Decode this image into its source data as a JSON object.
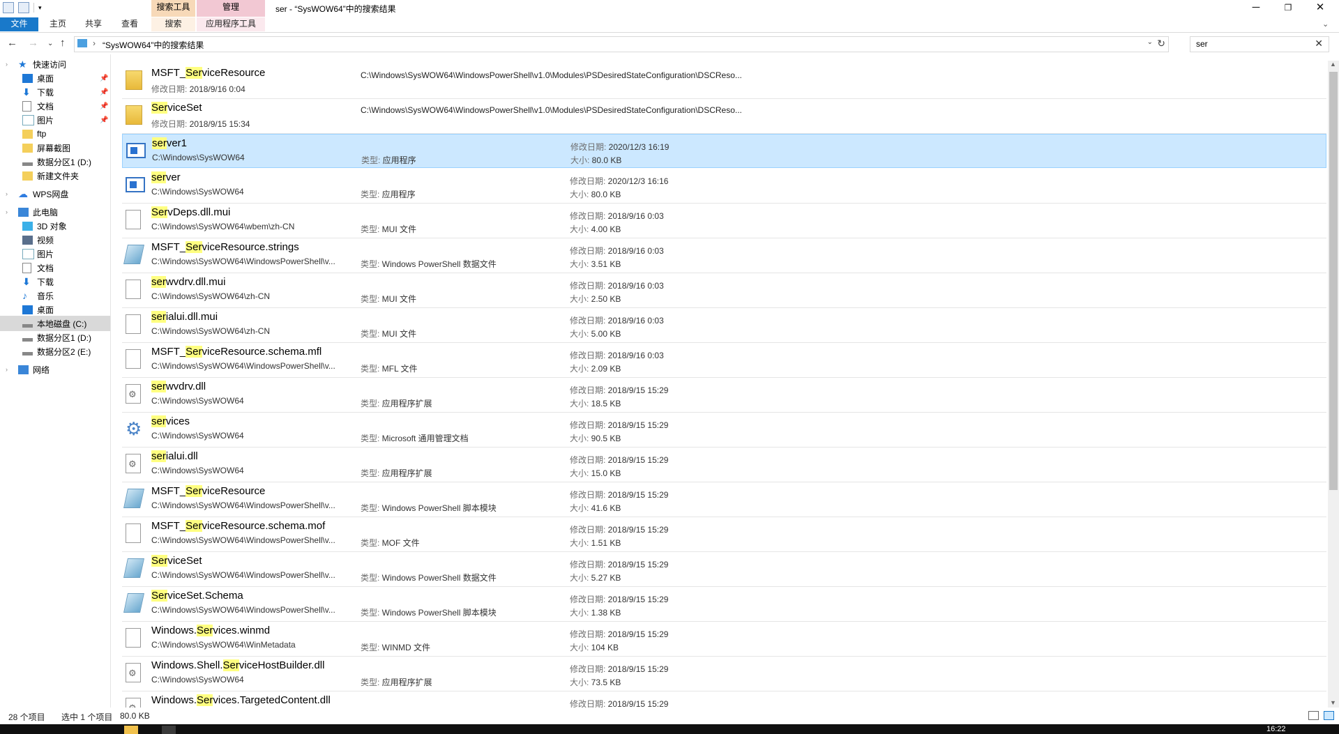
{
  "window": {
    "title": "ser - “SysWOW64”中的搜索结果",
    "context_tabs": {
      "search_tools": "搜索工具",
      "manage": "管理"
    },
    "controls": {
      "minimize": "─",
      "maximize": "❐",
      "close": "✕"
    }
  },
  "ribbon": {
    "tabs": {
      "file": "文件",
      "home": "主页",
      "share": "共享",
      "view": "查看",
      "search": "搜索",
      "app_tools": "应用程序工具"
    }
  },
  "address": {
    "path": "“SysWOW64”中的搜索结果",
    "search_value": "ser"
  },
  "sidebar": {
    "items": [
      {
        "label": "快速访问",
        "icon": "star-icon",
        "pinned": false
      },
      {
        "label": "桌面",
        "icon": "desktop-icon",
        "pinned": true
      },
      {
        "label": "下载",
        "icon": "download-icon",
        "pinned": true
      },
      {
        "label": "文档",
        "icon": "document-icon",
        "pinned": true
      },
      {
        "label": "图片",
        "icon": "picture-icon",
        "pinned": true
      },
      {
        "label": "ftp",
        "icon": "folder-icon",
        "pinned": false
      },
      {
        "label": "屏幕截图",
        "icon": "folder-icon",
        "pinned": false
      },
      {
        "label": "数据分区1 (D:)",
        "icon": "drive-icon",
        "pinned": false
      },
      {
        "label": "新建文件夹",
        "icon": "folder-icon",
        "pinned": false
      },
      {
        "label": "WPS网盘",
        "icon": "cloud-icon",
        "pinned": false
      },
      {
        "label": "此电脑",
        "icon": "pc-icon",
        "pinned": false
      },
      {
        "label": "3D 对象",
        "icon": "cube-icon",
        "pinned": false
      },
      {
        "label": "视频",
        "icon": "video-icon",
        "pinned": false
      },
      {
        "label": "图片",
        "icon": "picture-icon",
        "pinned": false
      },
      {
        "label": "文档",
        "icon": "document-icon",
        "pinned": false
      },
      {
        "label": "下载",
        "icon": "download-icon",
        "pinned": false
      },
      {
        "label": "音乐",
        "icon": "music-icon",
        "pinned": false
      },
      {
        "label": "桌面",
        "icon": "desktop-icon",
        "pinned": false
      },
      {
        "label": "本地磁盘 (C:)",
        "icon": "drive-icon",
        "pinned": false
      },
      {
        "label": "数据分区1 (D:)",
        "icon": "drive-icon",
        "pinned": false
      },
      {
        "label": "数据分区2 (E:)",
        "icon": "drive-icon",
        "pinned": false
      },
      {
        "label": "网络",
        "icon": "network-icon",
        "pinned": false
      }
    ]
  },
  "labels": {
    "modified": "修改日期:",
    "type": "类型:",
    "size": "大小:"
  },
  "files": [
    {
      "pre": "MSFT_",
      "hl": "Ser",
      "post": "viceResource",
      "path": "C:\\Windows\\SysWOW64\\WindowsPowerShell\\v1.0\\Modules\\PSDesiredStateConfiguration\\DSCReso...",
      "date": "2018/9/16 0:04",
      "type": "",
      "size": "",
      "icon": "folder-icon",
      "kind": "folder"
    },
    {
      "pre": "",
      "hl": "Ser",
      "post": "viceSet",
      "path": "C:\\Windows\\SysWOW64\\WindowsPowerShell\\v1.0\\Modules\\PSDesiredStateConfiguration\\DSCReso...",
      "date": "2018/9/15 15:34",
      "type": "",
      "size": "",
      "icon": "folder-icon",
      "kind": "folder"
    },
    {
      "pre": "",
      "hl": "ser",
      "post": "ver1",
      "path": "C:\\Windows\\SysWOW64",
      "date": "2020/12/3 16:19",
      "type": "应用程序",
      "size": "80.0 KB",
      "icon": "application-icon",
      "kind": "file",
      "selected": true
    },
    {
      "pre": "",
      "hl": "ser",
      "post": "ver",
      "path": "C:\\Windows\\SysWOW64",
      "date": "2020/12/3 16:16",
      "type": "应用程序",
      "size": "80.0 KB",
      "icon": "application-icon",
      "kind": "file"
    },
    {
      "pre": "",
      "hl": "Ser",
      "post": "vDeps.dll.mui",
      "path": "C:\\Windows\\SysWOW64\\wbem\\zh-CN",
      "date": "2018/9/16 0:03",
      "type": "MUI 文件",
      "size": "4.00 KB",
      "icon": "file-icon",
      "kind": "file"
    },
    {
      "pre": "MSFT_",
      "hl": "Ser",
      "post": "viceResource.strings",
      "path": "C:\\Windows\\SysWOW64\\WindowsPowerShell\\v...",
      "date": "2018/9/16 0:03",
      "type": "Windows PowerShell 数据文件",
      "size": "3.51 KB",
      "icon": "powershell-file-icon",
      "kind": "file"
    },
    {
      "pre": "",
      "hl": "ser",
      "post": "wvdrv.dll.mui",
      "path": "C:\\Windows\\SysWOW64\\zh-CN",
      "date": "2018/9/16 0:03",
      "type": "MUI 文件",
      "size": "2.50 KB",
      "icon": "file-icon",
      "kind": "file"
    },
    {
      "pre": "",
      "hl": "ser",
      "post": "ialui.dll.mui",
      "path": "C:\\Windows\\SysWOW64\\zh-CN",
      "date": "2018/9/16 0:03",
      "type": "MUI 文件",
      "size": "5.00 KB",
      "icon": "file-icon",
      "kind": "file"
    },
    {
      "pre": "MSFT_",
      "hl": "Ser",
      "post": "viceResource.schema.mfl",
      "path": "C:\\Windows\\SysWOW64\\WindowsPowerShell\\v...",
      "date": "2018/9/16 0:03",
      "type": "MFL 文件",
      "size": "2.09 KB",
      "icon": "file-icon",
      "kind": "file"
    },
    {
      "pre": "",
      "hl": "ser",
      "post": "wvdrv.dll",
      "path": "C:\\Windows\\SysWOW64",
      "date": "2018/9/15 15:29",
      "type": "应用程序扩展",
      "size": "18.5 KB",
      "icon": "dll-icon",
      "kind": "file"
    },
    {
      "pre": "",
      "hl": "ser",
      "post": "vices",
      "path": "C:\\Windows\\SysWOW64",
      "date": "2018/9/15 15:29",
      "type": "Microsoft 通用管理文档",
      "size": "90.5 KB",
      "icon": "gear-icon",
      "kind": "file"
    },
    {
      "pre": "",
      "hl": "ser",
      "post": "ialui.dll",
      "path": "C:\\Windows\\SysWOW64",
      "date": "2018/9/15 15:29",
      "type": "应用程序扩展",
      "size": "15.0 KB",
      "icon": "dll-icon",
      "kind": "file"
    },
    {
      "pre": "MSFT_",
      "hl": "Ser",
      "post": "viceResource",
      "path": "C:\\Windows\\SysWOW64\\WindowsPowerShell\\v...",
      "date": "2018/9/15 15:29",
      "type": "Windows PowerShell 脚本模块",
      "size": "41.6 KB",
      "icon": "powershell-file-icon",
      "kind": "file"
    },
    {
      "pre": "MSFT_",
      "hl": "Ser",
      "post": "viceResource.schema.mof",
      "path": "C:\\Windows\\SysWOW64\\WindowsPowerShell\\v...",
      "date": "2018/9/15 15:29",
      "type": "MOF 文件",
      "size": "1.51 KB",
      "icon": "file-icon",
      "kind": "file"
    },
    {
      "pre": "",
      "hl": "Ser",
      "post": "viceSet",
      "path": "C:\\Windows\\SysWOW64\\WindowsPowerShell\\v...",
      "date": "2018/9/15 15:29",
      "type": "Windows PowerShell 数据文件",
      "size": "5.27 KB",
      "icon": "powershell-file-icon",
      "kind": "file"
    },
    {
      "pre": "",
      "hl": "Ser",
      "post": "viceSet.Schema",
      "path": "C:\\Windows\\SysWOW64\\WindowsPowerShell\\v...",
      "date": "2018/9/15 15:29",
      "type": "Windows PowerShell 脚本模块",
      "size": "1.38 KB",
      "icon": "powershell-file-icon",
      "kind": "file"
    },
    {
      "pre": "Windows.",
      "hl": "Ser",
      "post": "vices.winmd",
      "path": "C:\\Windows\\SysWOW64\\WinMetadata",
      "date": "2018/9/15 15:29",
      "type": "WINMD 文件",
      "size": "104 KB",
      "icon": "file-icon",
      "kind": "file"
    },
    {
      "pre": "Windows.Shell.",
      "hl": "Ser",
      "post": "viceHostBuilder.dll",
      "path": "C:\\Windows\\SysWOW64",
      "date": "2018/9/15 15:29",
      "type": "应用程序扩展",
      "size": "73.5 KB",
      "icon": "dll-icon",
      "kind": "file"
    },
    {
      "pre": "Windows.",
      "hl": "Ser",
      "post": "vices.TargetedContent.dll",
      "path": "",
      "date": "2018/9/15 15:29",
      "type": "",
      "size": "",
      "icon": "dll-icon",
      "kind": "file"
    }
  ],
  "status": {
    "count": "28 个项目",
    "selected": "选中 1 个项目",
    "size": "80.0 KB"
  },
  "taskbar": {
    "clock": "16:22"
  },
  "colors": {
    "accent": "#1979ca",
    "selection": "#cce8ff",
    "highlight": "#ffff80"
  }
}
